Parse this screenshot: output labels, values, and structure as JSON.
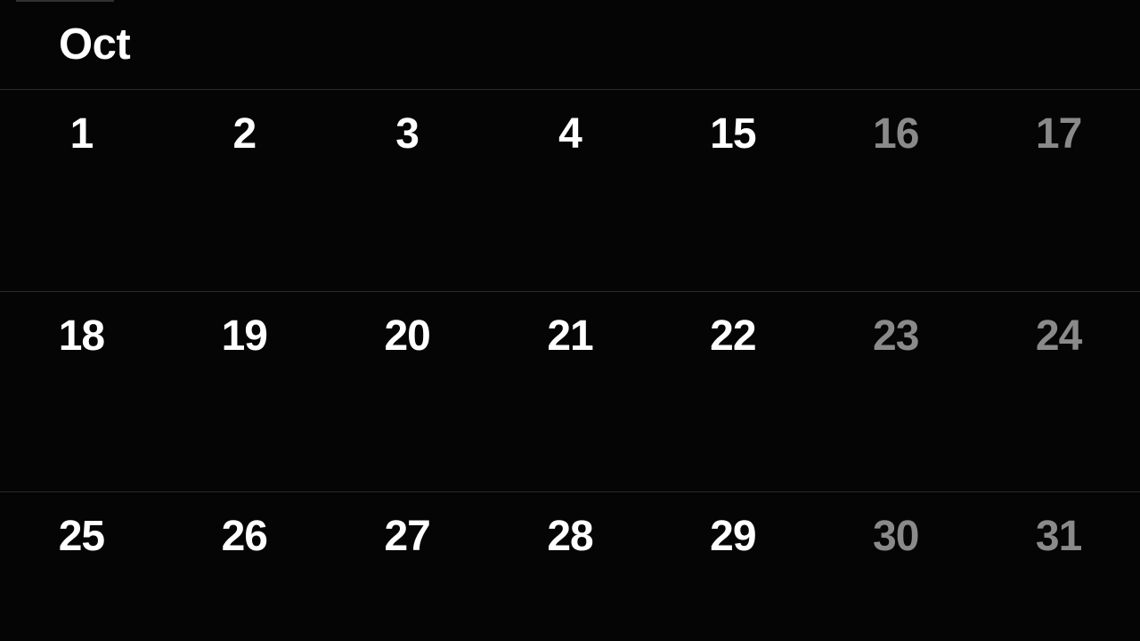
{
  "app": {
    "name": "calendar-month-view",
    "background_color": "#050505"
  },
  "header": {
    "month_label": "Oct",
    "title_color": "#ffffff"
  },
  "colors": {
    "background": "#050505",
    "weekday_text": "#ffffff",
    "weekend_text": "#8a8a8a",
    "divider": "#2b2b2b",
    "artifact_red": "#4a0d1b"
  },
  "weeks": [
    {
      "row_index": 0,
      "days": [
        {
          "label": "1",
          "dimmed": false
        },
        {
          "label": "2",
          "dimmed": false
        },
        {
          "label": "3",
          "dimmed": false
        },
        {
          "label": "4",
          "dimmed": false
        },
        {
          "label": "15",
          "dimmed": false
        },
        {
          "label": "16",
          "dimmed": true
        },
        {
          "label": "17",
          "dimmed": true
        }
      ]
    },
    {
      "row_index": 1,
      "days": [
        {
          "label": "18",
          "dimmed": false
        },
        {
          "label": "19",
          "dimmed": false
        },
        {
          "label": "20",
          "dimmed": false
        },
        {
          "label": "21",
          "dimmed": false
        },
        {
          "label": "22",
          "dimmed": false
        },
        {
          "label": "23",
          "dimmed": true
        },
        {
          "label": "24",
          "dimmed": true
        }
      ]
    },
    {
      "row_index": 2,
      "days": [
        {
          "label": "25",
          "dimmed": false
        },
        {
          "label": "26",
          "dimmed": false
        },
        {
          "label": "27",
          "dimmed": false
        },
        {
          "label": "28",
          "dimmed": false
        },
        {
          "label": "29",
          "dimmed": false
        },
        {
          "label": "30",
          "dimmed": true
        },
        {
          "label": "31",
          "dimmed": true
        }
      ]
    }
  ]
}
